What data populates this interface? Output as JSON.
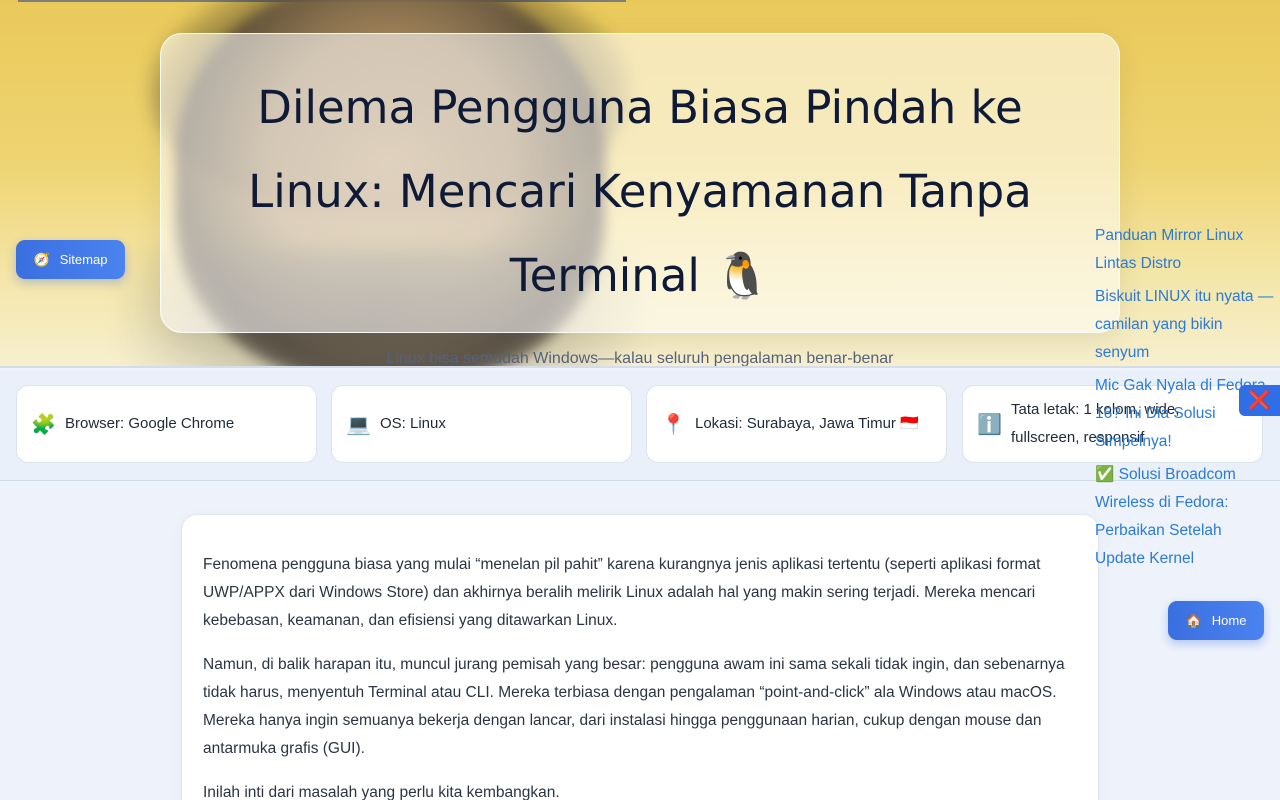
{
  "hero": {
    "title": "Dilema Pengguna Biasa Pindah ke Linux: Mencari Kenyamanan Tanpa Terminal 🐧",
    "subtitle": "Linux bisa semudah Windows—kalau seluruh pengalaman benar‑benar mouse‑driven. Zero‑CLI dari awal sampai harian."
  },
  "sitemap": {
    "icon": "compass-icon",
    "glyph": "🧭",
    "label": "Sitemap"
  },
  "info_cards": [
    {
      "icon": "puzzle-icon",
      "glyph": "🧩",
      "text": "Browser: Google Chrome"
    },
    {
      "icon": "laptop-icon",
      "glyph": "💻",
      "text": "OS: Linux"
    },
    {
      "icon": "pin-icon",
      "glyph": "📍",
      "text": "Lokasi: Surabaya, Jawa Timur 🇮🇩"
    },
    {
      "icon": "info-icon",
      "glyph": "ℹ️",
      "text": "Tata letak: 1 kolom, wide, fullscreen, responsif"
    }
  ],
  "article": {
    "paragraphs": [
      "Fenomena pengguna biasa yang mulai “menelan pil pahit” karena kurangnya jenis aplikasi tertentu (seperti aplikasi format UWP/APPX dari Windows Store) dan akhirnya beralih melirik Linux adalah hal yang makin sering terjadi. Mereka mencari kebebasan, keamanan, dan efisiensi yang ditawarkan Linux.",
      "Namun, di balik harapan itu, muncul jurang pemisah yang besar: pengguna awam ini sama sekali tidak ingin, dan sebenarnya tidak harus, menyentuh Terminal atau CLI. Mereka terbiasa dengan pengalaman “point‑and‑click” ala Windows atau macOS. Mereka hanya ingin semuanya bekerja dengan lancar, dari instalasi hingga penggunaan harian, cukup dengan mouse dan antarmuka grafis (GUI).",
      "Inilah inti dari masalah yang perlu kita kembangkan."
    ]
  },
  "side_links": [
    "Panduan Mirror Linux Lintas Distro",
    "Biskuit LINUX itu nyata — camilan yang bikin senyum",
    "Mic Gak Nyala di Fedora 16? Ini Dia Solusi Simpelnya!",
    "✅ Solusi Broadcom Wireless di Fedora: Perbaikan Setelah Update Kernel"
  ],
  "close_button": {
    "icon": "close-icon",
    "glyph": "❌"
  },
  "home": {
    "icon": "home-icon",
    "glyph": "🏠",
    "label": "Home"
  },
  "colors": {
    "accent": "#3a6fe0",
    "link": "#2a7ad6",
    "hero_bg": "#eed472"
  }
}
